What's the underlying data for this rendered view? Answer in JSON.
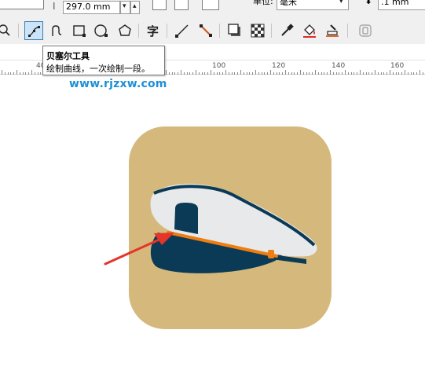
{
  "property_bar": {
    "height_value": "297.0 mm",
    "units_label": "单位:",
    "units_value": "毫米",
    "nudge_value": ".1 mm"
  },
  "toolbox": {
    "tools": [
      {
        "name": "zoom-icon",
        "active": false
      },
      {
        "name": "bezier-icon",
        "active": true
      },
      {
        "name": "freehand-icon",
        "active": false
      },
      {
        "name": "rectangle-icon",
        "active": false
      },
      {
        "name": "ellipse-icon",
        "active": false
      },
      {
        "name": "polygon-icon",
        "active": false
      },
      {
        "name": "text-icon",
        "active": false
      },
      {
        "name": "connector-icon",
        "active": false
      },
      {
        "name": "dimension-icon",
        "active": false
      },
      {
        "name": "drop-shadow-icon",
        "active": false
      },
      {
        "name": "transparency-icon",
        "active": false
      },
      {
        "name": "eyedropper-icon",
        "active": false
      },
      {
        "name": "fill-icon",
        "active": false
      },
      {
        "name": "smart-fill-icon",
        "active": false
      },
      {
        "name": "lock-icon",
        "active": false
      }
    ]
  },
  "ruler": {
    "labels": [
      "40",
      "100",
      "120",
      "140",
      "160"
    ]
  },
  "tooltip": {
    "title": "贝塞尔工具",
    "description": "绘制曲线，一次绘制一段。"
  },
  "watermark": {
    "text": "www.rjzxw.com"
  },
  "colors": {
    "icon_background": "#d5b97c",
    "cap_navy": "#0b3a56",
    "cap_white": "#e8e9eb",
    "band_orange": "#ef7d11",
    "arrow_red": "#e5352b",
    "watermark_blue": "#1e8fd6"
  }
}
